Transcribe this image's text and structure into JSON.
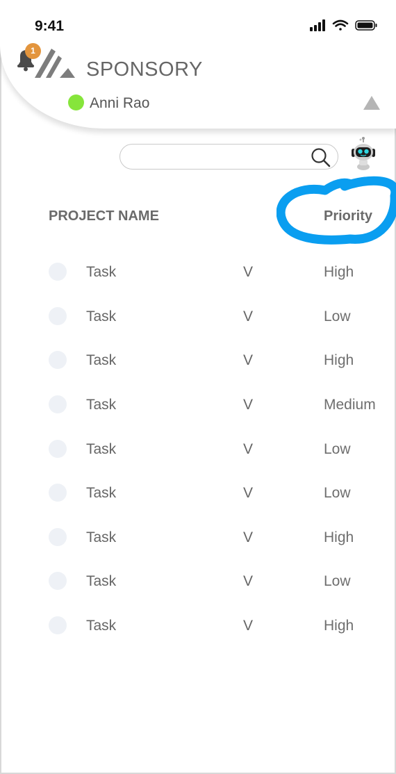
{
  "status_bar": {
    "time": "9:41",
    "icons": [
      "signal-icon",
      "wifi-icon",
      "battery-icon"
    ]
  },
  "header": {
    "notification_count": "1",
    "brand_name": "SPONSORY",
    "user_name": "Anni Rao",
    "online_color": "#86e53b",
    "badge_color": "#e3953d"
  },
  "search": {
    "placeholder": "",
    "value": ""
  },
  "table": {
    "columns": {
      "project": "PROJECT NAME",
      "priority": "Priority"
    },
    "highlight_color": "#0a9ef0",
    "rows": [
      {
        "name": "Task",
        "toggle": "V",
        "priority": "High"
      },
      {
        "name": "Task",
        "toggle": "V",
        "priority": "Low"
      },
      {
        "name": "Task",
        "toggle": "V",
        "priority": "High"
      },
      {
        "name": "Task",
        "toggle": "V",
        "priority": "Medium"
      },
      {
        "name": "Task",
        "toggle": "V",
        "priority": "Low"
      },
      {
        "name": "Task",
        "toggle": "V",
        "priority": "Low"
      },
      {
        "name": "Task",
        "toggle": "V",
        "priority": "High"
      },
      {
        "name": "Task",
        "toggle": "V",
        "priority": "Low"
      },
      {
        "name": "Task",
        "toggle": "V",
        "priority": "High"
      }
    ]
  }
}
